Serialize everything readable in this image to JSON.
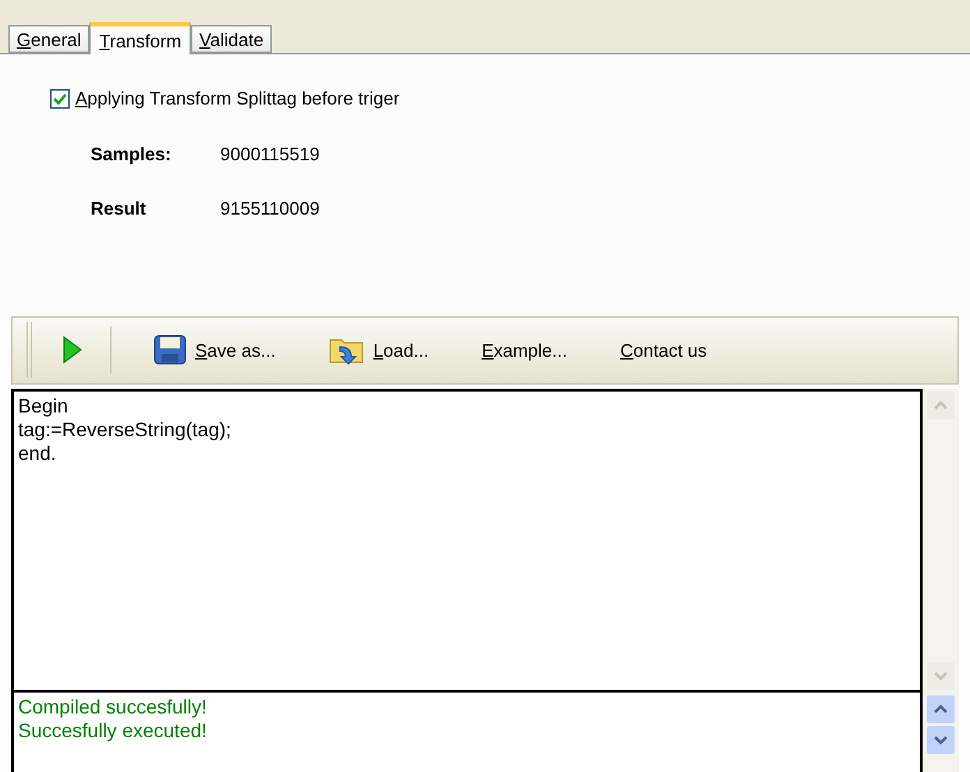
{
  "tabs": [
    {
      "label": "General",
      "selected": false
    },
    {
      "label": "Transform",
      "selected": true
    },
    {
      "label": "Validate",
      "selected": false
    }
  ],
  "apply_checkbox": {
    "label": "Applying Transform Splittag before triger",
    "checked": true
  },
  "fields": [
    {
      "label": "Samples:",
      "value": "9000115519"
    },
    {
      "label": "Result",
      "value": "9155110009"
    }
  ],
  "toolbar": [
    {
      "kind": "run"
    },
    {
      "kind": "save",
      "label": "Save as..."
    },
    {
      "kind": "load",
      "label": "Load..."
    },
    {
      "kind": "button",
      "label": "Example..."
    },
    {
      "kind": "button",
      "label": "Contact us"
    }
  ],
  "editor": {
    "lines": [
      "Begin",
      "tag:=ReverseString(tag);",
      "end."
    ]
  },
  "output": {
    "lines": [
      "Compiled succesfully!",
      "Succesfully executed!"
    ]
  }
}
